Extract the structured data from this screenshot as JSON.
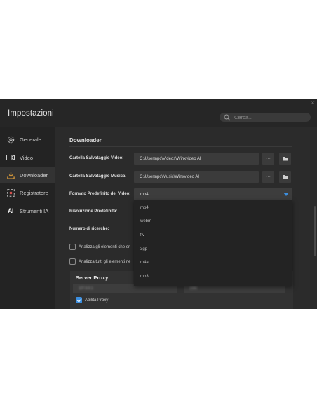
{
  "window": {
    "title": "Impostazioni",
    "close_glyph": "×"
  },
  "search": {
    "placeholder": "Cerca...",
    "icon": "search-icon"
  },
  "sidebar": {
    "items": [
      {
        "label": "Generale",
        "icon": "gear-icon"
      },
      {
        "label": "Video",
        "icon": "video-camera-icon"
      },
      {
        "label": "Downloader",
        "icon": "download-icon"
      },
      {
        "label": "Registratore",
        "icon": "record-icon"
      },
      {
        "label": "Strumenti IA",
        "icon": "ai-icon",
        "icon_text": "AI"
      }
    ],
    "active_index": 2
  },
  "downloader": {
    "section_title": "Downloader",
    "video_folder": {
      "label": "Cartella Salvataggio Video:",
      "value": "C:\\Users\\pc\\Videos\\Winxvideo AI"
    },
    "music_folder": {
      "label": "Cartella Salvataggio Musica:",
      "value": "C:\\Users\\pc\\Music\\Winxvideo AI"
    },
    "more_glyph": "···",
    "folder_glyph": "▬",
    "format": {
      "label": "Formato Predefinito del Video:",
      "selected": "mp4",
      "options": [
        "mp4",
        "webm",
        "flv",
        "3gp",
        "m4a",
        "mp3"
      ]
    },
    "resolution_label": "Risoluzione Predefinita:",
    "search_count_label": "Numero di ricerche:",
    "checkbox_1": "Analizza gli elementi che er",
    "checkbox_2": "Analizza tutti gli elementi ne",
    "proxy": {
      "title": "Server Proxy:",
      "host_value": "127.0.0.1",
      "port_value": "1080",
      "enable_label": "Abilita Proxy",
      "enabled": true
    }
  },
  "colors": {
    "accent": "#3c8fe0",
    "window_bg": "#2b2b2b",
    "sidebar_bg": "#232323"
  }
}
